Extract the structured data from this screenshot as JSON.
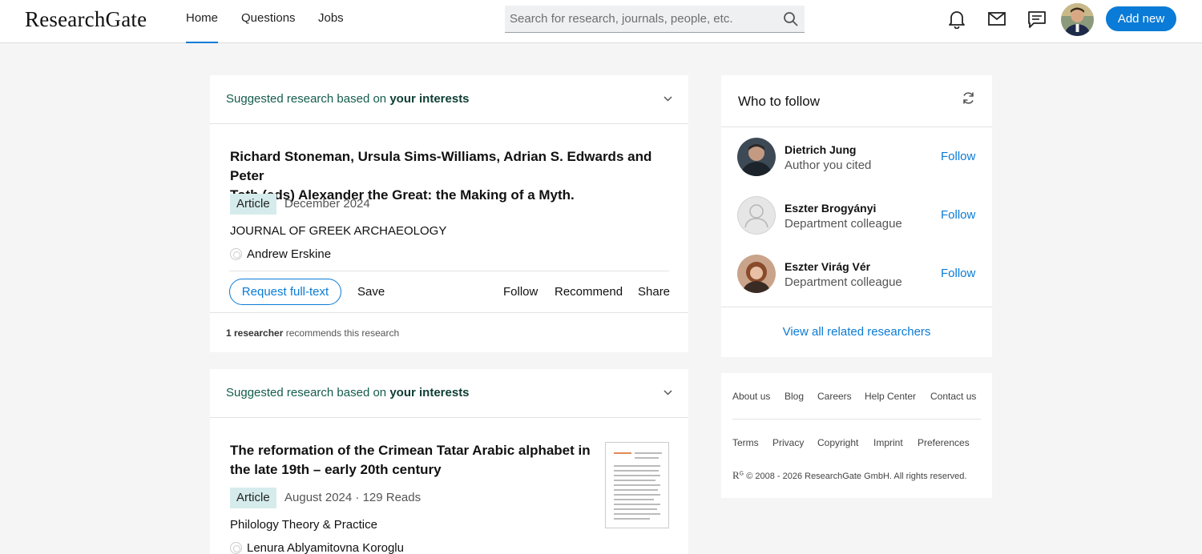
{
  "header": {
    "logo": "ResearchGate",
    "nav": [
      "Home",
      "Questions",
      "Jobs"
    ],
    "search_placeholder": "Search for research, journals, people, etc.",
    "add_new": "Add new",
    "accent": "#0a7bd6"
  },
  "feed": [
    {
      "heading_prefix": "Suggested research based on",
      "heading_bold": "your interests",
      "title_line1": "Richard Stoneman, Ursula Sims-Williams, Adrian S. Edwards and Peter",
      "title_line2": "Toth (eds) Alexander the Great: the Making of a Myth.",
      "type": "Article",
      "date": "December 2024",
      "journal": "JOURNAL OF GREEK ARCHAEOLOGY",
      "author": "Andrew Erskine",
      "actions": {
        "request": "Request full-text",
        "save": "Save",
        "follow": "Follow",
        "recommend": "Recommend",
        "share": "Share"
      },
      "footer_bold": "1 researcher",
      "footer_rest": "recommends this research"
    },
    {
      "heading_prefix": "Suggested research based on",
      "heading_bold": "your interests",
      "title_line1": "The reformation of the Crimean Tatar Arabic alphabet in",
      "title_line2": "the late 19th – early 20th century",
      "type": "Article",
      "date": "August 2024 · 129 Reads",
      "journal": "Philology Theory & Practice",
      "author": "Lenura Ablyamitovna Koroglu"
    }
  ],
  "who_to_follow": {
    "title": "Who to follow",
    "people": [
      {
        "name": "Dietrich Jung",
        "role": "Author you cited",
        "action": "Follow"
      },
      {
        "name": "Eszter Brogyányi",
        "role": "Department colleague",
        "action": "Follow"
      },
      {
        "name": "Eszter Virág Vér",
        "role": "Department colleague",
        "action": "Follow"
      }
    ],
    "view_all": "View all related researchers"
  },
  "footer": {
    "row1": [
      "About us",
      "Blog",
      "Careers",
      "Help Center",
      "Contact us"
    ],
    "row2": [
      "Terms",
      "Privacy",
      "Copyright",
      "Imprint",
      "Preferences"
    ],
    "copyright_mark": "R",
    "copyright_sup": "G",
    "copyright": "© 2008 - 2026 ResearchGate GmbH. All rights reserved."
  }
}
